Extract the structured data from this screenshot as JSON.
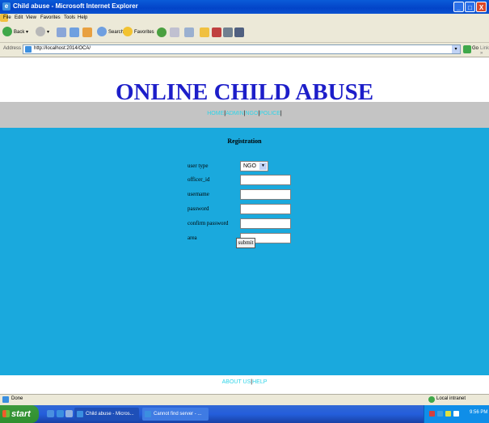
{
  "window": {
    "title": "Child abuse - Microsoft Internet Explorer",
    "min_label": "_",
    "max_label": "□",
    "close_label": "X"
  },
  "menu": [
    "File",
    "Edit",
    "View",
    "Favorites",
    "Tools",
    "Help"
  ],
  "toolbar": {
    "back_label": "Back",
    "search_label": "Search",
    "favorites_label": "Favorites"
  },
  "address": {
    "label": "Address",
    "url": "http://localhost:2014/OCA/",
    "go_label": "Go",
    "links_label": "Links »"
  },
  "page": {
    "site_title": "ONLINE CHILD ABUSE",
    "nav": [
      "HOME",
      "ADMIN",
      "NGO",
      "POLICE"
    ],
    "registration_title": "Registration",
    "form": {
      "user_type_label": "user type",
      "user_type_value": "NGO",
      "officer_id_label": "officer_id",
      "username_label": "username",
      "password_label": "password",
      "confirm_password_label": "confirm password",
      "area_label": "area",
      "submit_label": "submit"
    },
    "footer_links": [
      "ABOUT US",
      "HELP"
    ]
  },
  "status": {
    "text": "Done",
    "zone": "Local intranet"
  },
  "taskbar": {
    "start_label": "start",
    "tasks": [
      "Child abuse - Micros...",
      "Cannot find server - ..."
    ],
    "clock": "9:56 PM"
  }
}
